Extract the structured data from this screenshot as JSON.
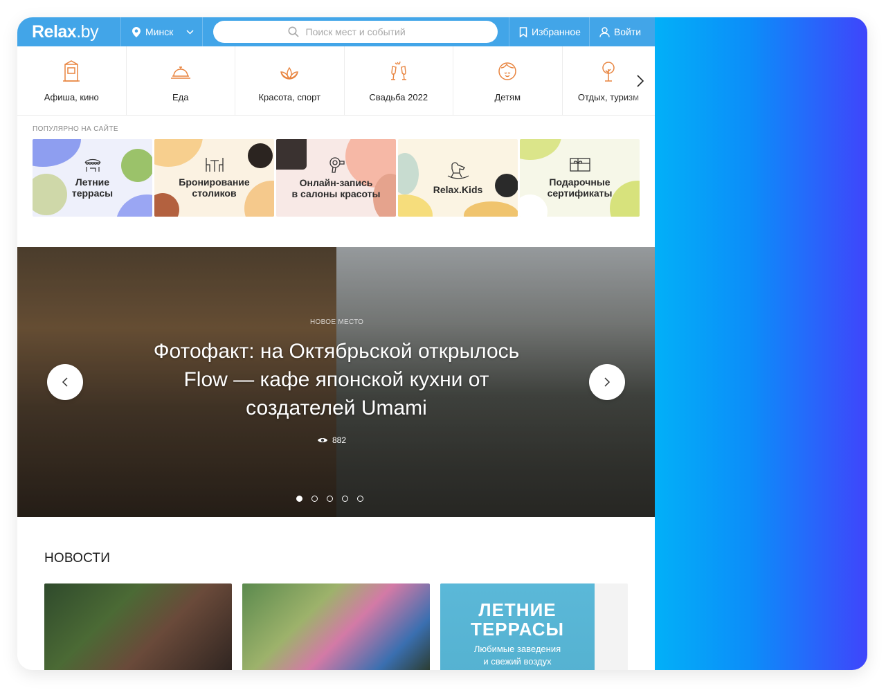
{
  "header": {
    "logo": "Relax",
    "logo_suffix": ".by",
    "city": "Минск",
    "search_placeholder": "Поиск мест и событий",
    "favorites": "Избранное",
    "login": "Войти"
  },
  "categories": [
    {
      "label": "Афиша, кино",
      "icon": "booth-icon"
    },
    {
      "label": "Еда",
      "icon": "cloche-icon"
    },
    {
      "label": "Красота, спорт",
      "icon": "lotus-icon"
    },
    {
      "label": "Свадьба 2022",
      "icon": "champagne-icon"
    },
    {
      "label": "Детям",
      "icon": "child-face-icon"
    },
    {
      "label": "Отдых, туризм",
      "icon": "tree-icon"
    }
  ],
  "popular": {
    "title": "ПОПУЛЯРНО НА САЙТЕ",
    "items": [
      {
        "label": "Летние\nтеррасы"
      },
      {
        "label": "Бронирование\nстоликов"
      },
      {
        "label": "Онлайн-запись\nв салоны красоты"
      },
      {
        "label": "Relax.Kids"
      },
      {
        "label": "Подарочные\nсертификаты"
      }
    ]
  },
  "slider": {
    "kicker": "НОВОЕ МЕСТО",
    "title": "Фотофакт: на Октябрьской открылось Flow — кафе японской кухни от создателей Umami",
    "views": "882",
    "active_index": 0,
    "total": 5
  },
  "news": {
    "title": "НОВОСТИ",
    "cards": [
      {
        "id": "n1"
      },
      {
        "id": "n2"
      },
      {
        "id": "n3",
        "headline": "ЛЕТНИЕ\nТЕРРАСЫ",
        "sub": "Любимые заведения\nи свежий воздух"
      }
    ]
  },
  "colors": {
    "header_blue": "#42a5e8",
    "icon_orange": "#e8843f",
    "gradient_start": "#02b0f8",
    "gradient_end": "#3f45fb"
  }
}
